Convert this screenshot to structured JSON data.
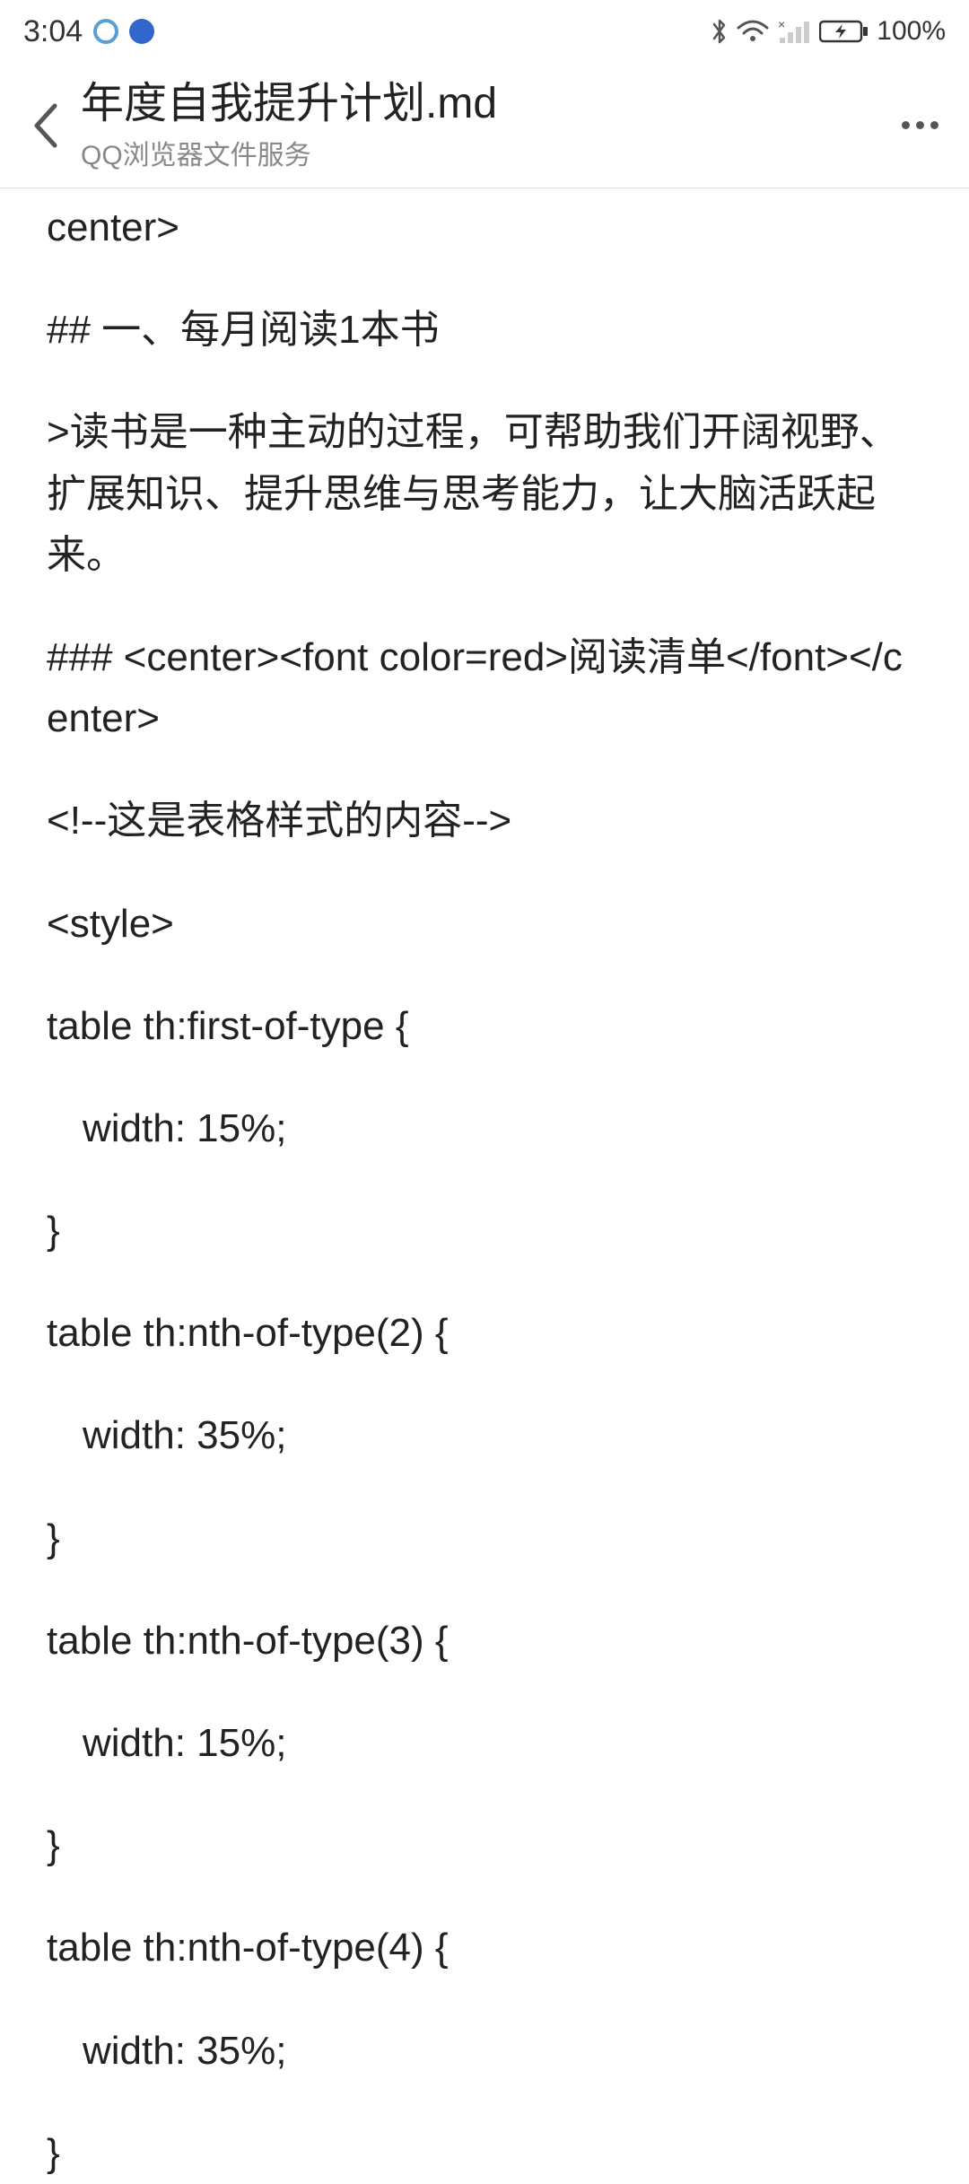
{
  "status": {
    "time": "3:04",
    "battery": "100%"
  },
  "header": {
    "title": "年度自我提升计划.md",
    "subtitle": "QQ浏览器文件服务"
  },
  "content": {
    "lines": [
      "center>",
      "## 一、每月阅读1本书",
      ">读书是一种主动的过程，可帮助我们开阔视野、扩展知识、提升思维与思考能力，让大脑活跃起来。",
      "### <center><font color=red>阅读清单</font></center>",
      "<!--这是表格样式的内容-->",
      "<style>",
      "table th:first-of-type {",
      "width: 15%;",
      "}",
      "table th:nth-of-type(2) {",
      "width: 35%;",
      "}",
      "table th:nth-of-type(3) {",
      "width: 15%;",
      "}",
      "table th:nth-of-type(4) {",
      "width: 35%;",
      "}"
    ]
  }
}
